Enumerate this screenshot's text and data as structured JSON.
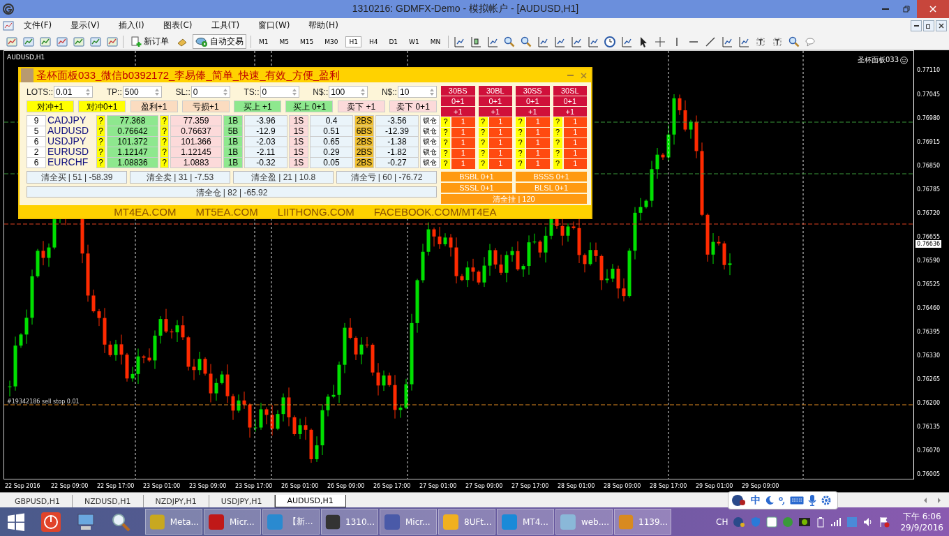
{
  "window": {
    "title": "1310216: GDMFX-Demo - 模拟帐户 - [AUDUSD,H1]"
  },
  "menu": [
    "文件(F)",
    "显示(V)",
    "插入(I)",
    "图表(C)",
    "工具(T)",
    "窗口(W)",
    "帮助(H)"
  ],
  "toolbar": {
    "new_order": "新订单",
    "auto_trading": "自动交易",
    "timeframes": [
      {
        "label": "M1",
        "selected": false
      },
      {
        "label": "M5",
        "selected": false
      },
      {
        "label": "M15",
        "selected": false
      },
      {
        "label": "M30",
        "selected": false
      },
      {
        "label": "H1",
        "selected": true
      },
      {
        "label": "H4",
        "selected": false
      },
      {
        "label": "D1",
        "selected": false
      },
      {
        "label": "W1",
        "selected": false
      },
      {
        "label": "MN",
        "selected": false
      }
    ]
  },
  "chart": {
    "symbol_label": "AUDUSD,H1",
    "indicator_label": "圣杯面板033",
    "order_label": "#19342186 sell stop 0.01",
    "current_price": "0.76636",
    "price_labels": [
      "0.77110",
      "0.77045",
      "0.76980",
      "0.76915",
      "0.76850",
      "0.76785",
      "0.76720",
      "0.76655",
      "0.76590",
      "0.76525",
      "0.76460",
      "0.76395",
      "0.76330",
      "0.76265",
      "0.76200",
      "0.76135",
      "0.76070",
      "0.76005"
    ],
    "time_labels": [
      "22 Sep 2016",
      "22 Sep 09:00",
      "22 Sep 17:00",
      "23 Sep 01:00",
      "23 Sep 09:00",
      "23 Sep 17:00",
      "26 Sep 01:00",
      "26 Sep 09:00",
      "26 Sep 17:00",
      "27 Sep 01:00",
      "27 Sep 09:00",
      "27 Sep 17:00",
      "28 Sep 01:00",
      "28 Sep 09:00",
      "28 Sep 17:00",
      "29 Sep 01:00",
      "29 Sep 09:00"
    ]
  },
  "panel": {
    "title": "圣杯面板033_微信b0392172_李易俸_简单_快速_有效_方便_盈利",
    "inputs": [
      {
        "label": "LOTS::",
        "value": "0.01"
      },
      {
        "label": "TP::",
        "value": "500"
      },
      {
        "label": "SL::",
        "value": "0"
      },
      {
        "label": "TS::",
        "value": "0"
      },
      {
        "label": "N$::",
        "value": "100"
      },
      {
        "label": "N$::",
        "value": "10"
      }
    ],
    "actions": [
      {
        "label": "对冲+1",
        "kind": "hedge"
      },
      {
        "label": "对冲0+1",
        "kind": "hedge"
      },
      {
        "label": "盈利+1",
        "kind": "profit"
      },
      {
        "label": "亏损+1",
        "kind": "profit"
      },
      {
        "label": "买上 +1",
        "kind": "buy"
      },
      {
        "label": "买上 0+1",
        "kind": "buy"
      },
      {
        "label": "卖下 +1",
        "kind": "sell"
      },
      {
        "label": "卖下 0+1",
        "kind": "sell"
      }
    ],
    "rows": [
      {
        "count": "9",
        "symbol": "CADJPY",
        "ask_tag": "?",
        "ask": "77.368",
        "bid_tag": "?",
        "bid": "77.359",
        "buy_lots": "1B",
        "buy_profit": "-3.96",
        "sell_lots": "1S",
        "sell_profit": "0.4",
        "both_lots": "2BS",
        "both_profit": "-3.56",
        "lock": "锁仓"
      },
      {
        "count": "5",
        "symbol": "AUDUSD",
        "ask_tag": "?",
        "ask": "0.76642",
        "bid_tag": "?",
        "bid": "0.76637",
        "buy_lots": "5B",
        "buy_profit": "-12.9",
        "sell_lots": "1S",
        "sell_profit": "0.51",
        "both_lots": "6BS",
        "both_profit": "-12.39",
        "lock": "锁仓"
      },
      {
        "count": "6",
        "symbol": "USDJPY",
        "ask_tag": "?",
        "ask": "101.372",
        "bid_tag": "?",
        "bid": "101.366",
        "buy_lots": "1B",
        "buy_profit": "-2.03",
        "sell_lots": "1S",
        "sell_profit": "0.65",
        "both_lots": "2BS",
        "both_profit": "-1.38",
        "lock": "锁仓"
      },
      {
        "count": "2",
        "symbol": "EURUSD",
        "ask_tag": "?",
        "ask": "1.12147",
        "bid_tag": "?",
        "bid": "1.12145",
        "buy_lots": "1B",
        "buy_profit": "-2.11",
        "sell_lots": "1S",
        "sell_profit": "0.29",
        "both_lots": "2BS",
        "both_profit": "-1.82",
        "lock": "锁仓"
      },
      {
        "count": "6",
        "symbol": "EURCHF",
        "ask_tag": "?",
        "ask": "1.08836",
        "bid_tag": "?",
        "bid": "1.0883",
        "buy_lots": "1B",
        "buy_profit": "-0.32",
        "sell_lots": "1S",
        "sell_profit": "0.05",
        "both_lots": "2BS",
        "both_profit": "-0.27",
        "lock": "锁仓"
      }
    ],
    "close_buttons": [
      "清全买 | 51 | -58.39",
      "清全卖 | 31 | -7.53",
      "清全盈 | 21 | 10.8",
      "清全亏 | 60 | -76.72"
    ],
    "close_all": "清全仓 | 82 | -65.92",
    "grid_columns": [
      {
        "label": "30BS",
        "open": "0+1",
        "add": "+1",
        "cells": [
          {
            "tag": "?",
            "value": "1"
          },
          {
            "tag": "?",
            "value": "1"
          },
          {
            "tag": "?",
            "value": "1"
          },
          {
            "tag": "?",
            "value": "1"
          },
          {
            "tag": "?",
            "value": "1"
          }
        ]
      },
      {
        "label": "30BL",
        "open": "0+1",
        "add": "+1",
        "cells": [
          {
            "tag": "?",
            "value": "1"
          },
          {
            "tag": "?",
            "value": "1"
          },
          {
            "tag": "?",
            "value": "1"
          },
          {
            "tag": "?",
            "value": "1"
          },
          {
            "tag": "?",
            "value": "1"
          }
        ]
      },
      {
        "label": "30SS",
        "open": "0+1",
        "add": "+1",
        "cells": [
          {
            "tag": "?",
            "value": "1"
          },
          {
            "tag": "?",
            "value": "1"
          },
          {
            "tag": "?",
            "value": "1"
          },
          {
            "tag": "?",
            "value": "1"
          },
          {
            "tag": "?",
            "value": "1"
          }
        ]
      },
      {
        "label": "30SL",
        "open": "0+1",
        "add": "+1",
        "cells": [
          {
            "tag": "?",
            "value": "1"
          },
          {
            "tag": "?",
            "value": "1"
          },
          {
            "tag": "?",
            "value": "1"
          },
          {
            "tag": "?",
            "value": "1"
          },
          {
            "tag": "?",
            "value": "1"
          }
        ]
      }
    ],
    "combo_buttons": [
      "BSBL 0+1",
      "BSSS 0+1",
      "SSSL 0+1",
      "BLSL 0+1"
    ],
    "clear_pending": "清全挂 | 120",
    "footer_links": [
      "MT4EA.COM",
      "MT5EA.COM",
      "LIITHONG.COM",
      "FACEBOOK.COM/MT4EA"
    ]
  },
  "chart_tabs": [
    {
      "label": "GBPUSD,H1",
      "selected": false
    },
    {
      "label": "NZDUSD,H1",
      "selected": false
    },
    {
      "label": "NZDJPY,H1",
      "selected": false
    },
    {
      "label": "USDJPY,H1",
      "selected": false
    },
    {
      "label": "AUDUSD,H1",
      "selected": true
    }
  ],
  "ime_bar": {
    "mode": "中"
  },
  "taskbar": {
    "items": [
      {
        "label": "Meta..."
      },
      {
        "label": "Micr..."
      },
      {
        "label": "【新..."
      },
      {
        "label": "1310..."
      },
      {
        "label": "Micr..."
      },
      {
        "label": "8UFt..."
      },
      {
        "label": "MT4..."
      },
      {
        "label": "web...."
      },
      {
        "label": "1139..."
      }
    ],
    "language": "CH",
    "time": "下午 6:06",
    "date": "29/9/2016"
  }
}
